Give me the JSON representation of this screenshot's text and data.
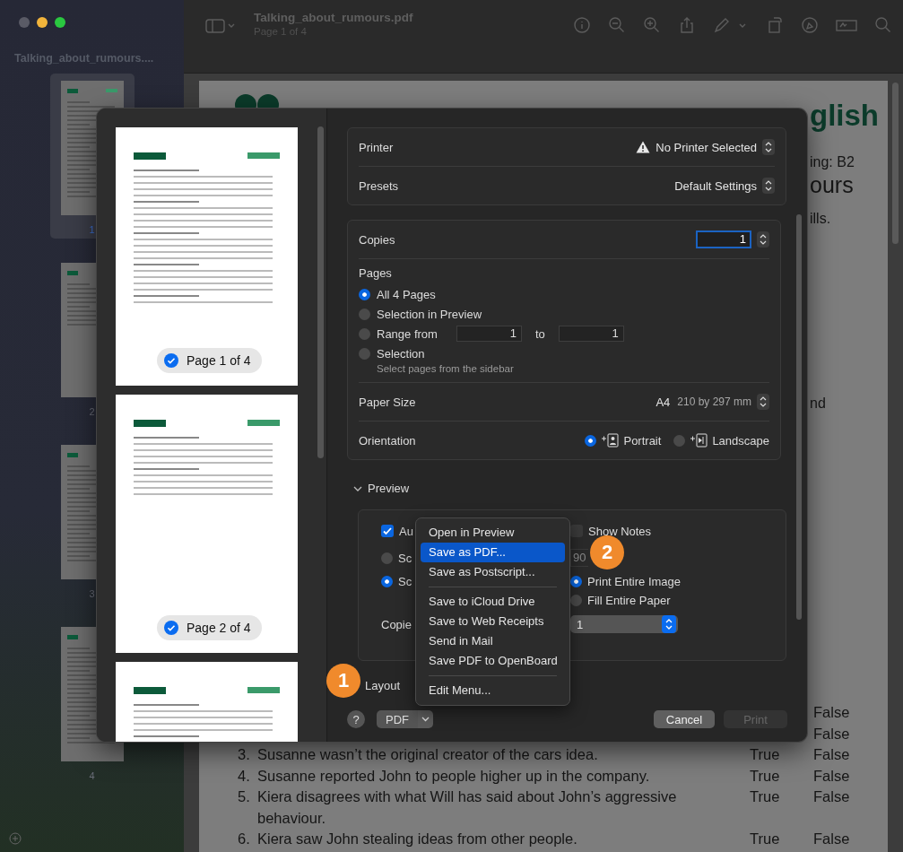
{
  "window": {
    "title": "Talking_about_rumours.pdf",
    "subtitle": "Page 1 of 4"
  },
  "sidebar": {
    "title": "Talking_about_rumours....",
    "pages": [
      {
        "number": "1",
        "selected": true
      },
      {
        "number": "2",
        "selected": false
      },
      {
        "number": "3",
        "selected": false
      },
      {
        "number": "4",
        "selected": false
      }
    ]
  },
  "document": {
    "fragments": [
      {
        "kind": "brand",
        "text": "glish"
      },
      {
        "kind": "label",
        "text": "ing: B2"
      },
      {
        "kind": "title",
        "text": "ours"
      },
      {
        "kind": "body",
        "text": "ills."
      },
      {
        "kind": "body",
        "text": "nd"
      }
    ],
    "questions": [
      {
        "false": "False"
      },
      {
        "false": "False"
      },
      {
        "number": "3.",
        "text": "Susanne wasn’t the original creator of the cars idea.",
        "true": "True",
        "false": "False"
      },
      {
        "number": "4.",
        "text": "Susanne reported John to people higher up in the company.",
        "true": "True",
        "false": "False"
      },
      {
        "number": "5.",
        "text": "Kiera disagrees with what Will has said about John’s aggressive behaviour.",
        "true": "True",
        "false": "False"
      },
      {
        "number": "6.",
        "text": "Kiera saw John stealing ideas from other people.",
        "true": "True",
        "false": "False"
      }
    ]
  },
  "print_dialog": {
    "thumbnails": [
      {
        "label": "Page 1 of 4",
        "selected": true
      },
      {
        "label": "Page 2 of 4",
        "selected": true
      }
    ],
    "more_pages": true,
    "printer": {
      "label": "Printer",
      "value": "No Printer Selected",
      "warning": true
    },
    "presets": {
      "label": "Presets",
      "value": "Default Settings"
    },
    "copies": {
      "label": "Copies",
      "value": "1"
    },
    "pages": {
      "label": "Pages",
      "options": [
        {
          "kind": "plain",
          "label": "All 4 Pages",
          "selected": true
        },
        {
          "kind": "plain",
          "label": "Selection in Preview",
          "selected": false
        },
        {
          "kind": "range",
          "label": "Range from",
          "selected": false,
          "from": "1",
          "to_label": "to",
          "to": "1"
        },
        {
          "kind": "hint",
          "label": "Selection",
          "selected": false,
          "hint": "Select pages from the sidebar"
        }
      ]
    },
    "paper_size": {
      "label": "Paper Size",
      "value": "A4",
      "detail": "210 by 297 mm"
    },
    "orientation": {
      "label": "Orientation",
      "options": [
        {
          "kind": "portrait",
          "label": "Portrait",
          "selected": true
        },
        {
          "kind": "landscape",
          "label": "Landscape",
          "selected": false
        }
      ]
    },
    "preview": {
      "label": "Preview",
      "expanded": true,
      "auto": {
        "label": "Au",
        "checked": true
      },
      "show_notes": {
        "label": "Show Notes",
        "checked": false
      },
      "scale_options": [
        {
          "label": "Sc",
          "selected": false,
          "value": "90",
          "disabled": true
        },
        {
          "label": "Sc",
          "selected": true
        }
      ],
      "fit_options": [
        {
          "label": "Print Entire Image",
          "selected": true
        },
        {
          "label": "Fill Entire Paper",
          "selected": false
        }
      ],
      "copies_label": "Copie",
      "copies_value": "1"
    },
    "layout": {
      "label": "Layout"
    },
    "help": "?",
    "pdf": "PDF",
    "cancel": "Cancel",
    "print": {
      "label": "Print",
      "disabled": true
    }
  },
  "pdf_menu": [
    {
      "kind": "item",
      "label": "Open in Preview",
      "selected": false
    },
    {
      "kind": "item",
      "label": "Save as PDF...",
      "selected": true
    },
    {
      "kind": "item",
      "label": "Save as Postscript...",
      "selected": false
    },
    {
      "kind": "separator"
    },
    {
      "kind": "item",
      "label": "Save to iCloud Drive",
      "selected": false
    },
    {
      "kind": "item",
      "label": "Save to Web Receipts",
      "selected": false
    },
    {
      "kind": "item",
      "label": "Send in Mail",
      "selected": false
    },
    {
      "kind": "item",
      "label": "Save PDF to OpenBoard",
      "selected": false
    },
    {
      "kind": "separator"
    },
    {
      "kind": "item",
      "label": "Edit Menu...",
      "selected": false
    }
  ],
  "annotations": [
    {
      "label": "1"
    },
    {
      "label": "2"
    }
  ]
}
